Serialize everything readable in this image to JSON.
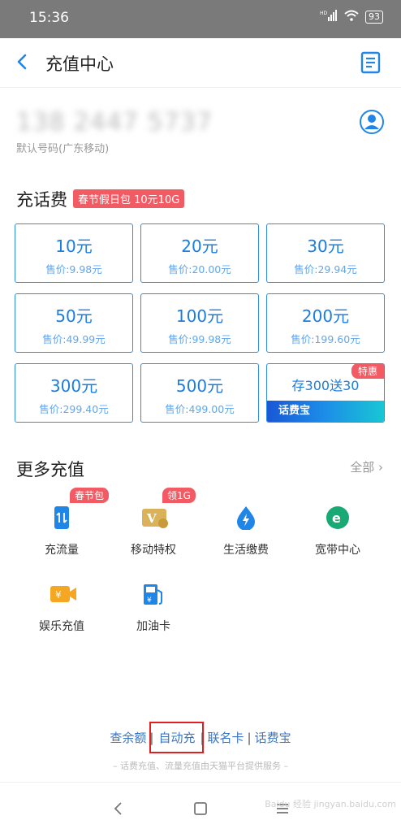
{
  "status": {
    "time": "15:36",
    "signal": "HD",
    "battery": "93"
  },
  "nav": {
    "title": "充值中心"
  },
  "phone": {
    "number": "138 2447 5737",
    "subtitle": "默认号码(广东移动)"
  },
  "recharge": {
    "title": "充话费",
    "promo": "春节假日包 10元10G",
    "cards": [
      {
        "amount": "10元",
        "price": "售价:9.98元"
      },
      {
        "amount": "20元",
        "price": "售价:20.00元"
      },
      {
        "amount": "30元",
        "price": "售价:29.94元"
      },
      {
        "amount": "50元",
        "price": "售价:49.99元"
      },
      {
        "amount": "100元",
        "price": "售价:99.98元"
      },
      {
        "amount": "200元",
        "price": "售价:199.60元"
      },
      {
        "amount": "300元",
        "price": "售价:299.40元"
      },
      {
        "amount": "500元",
        "price": "售价:499.00元"
      }
    ],
    "special": {
      "text": "存300送30",
      "tag": "特惠",
      "brand": "话费宝"
    }
  },
  "more": {
    "title": "更多充值",
    "all": "全部",
    "items": [
      {
        "label": "充流量",
        "badge": "春节包",
        "color": "#1f86e8"
      },
      {
        "label": "移动特权",
        "badge": "领1G",
        "color": "#d9b25a"
      },
      {
        "label": "生活缴费",
        "badge": "",
        "color": "#1f86e8"
      },
      {
        "label": "宽带中心",
        "badge": "",
        "color": "#19a974"
      },
      {
        "label": "娱乐充值",
        "badge": "",
        "color": "#f5a623"
      },
      {
        "label": "加油卡",
        "badge": "",
        "color": "#1f86e8"
      }
    ]
  },
  "footer": {
    "links": [
      "查余额",
      "自动充",
      "联名卡",
      "话费宝"
    ],
    "note": "– 话费充值、流量充值由天猫平台提供服务 –"
  },
  "watermark": "Baidu 经验 jingyan.baidu.com"
}
